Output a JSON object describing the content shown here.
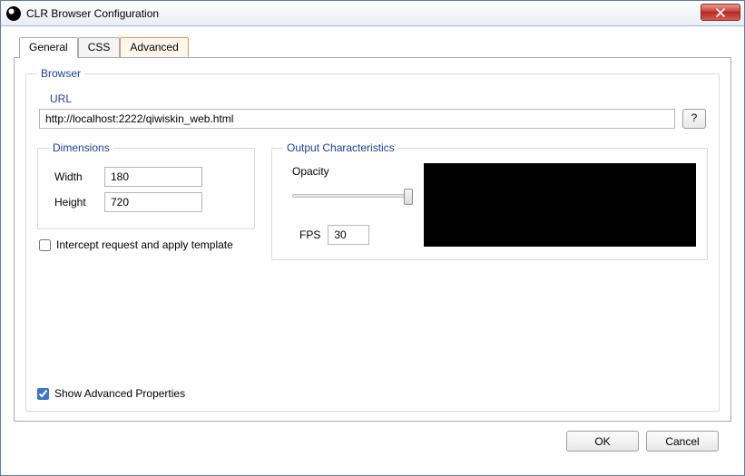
{
  "window": {
    "title": "CLR Browser Configuration"
  },
  "tabs": {
    "general": "General",
    "css": "CSS",
    "advanced": "Advanced"
  },
  "browser": {
    "legend": "Browser",
    "url_label": "URL",
    "url_value": "http://localhost:2222/qiwiskin_web.html",
    "help_label": "?"
  },
  "dimensions": {
    "legend": "Dimensions",
    "width_label": "Width",
    "width_value": "180",
    "height_label": "Height",
    "height_value": "720"
  },
  "intercept": {
    "label": "Intercept request and apply template",
    "checked": false
  },
  "output": {
    "legend": "Output Characteristics",
    "opacity_label": "Opacity",
    "opacity_value": 100,
    "fps_label": "FPS",
    "fps_value": "30"
  },
  "show_advanced": {
    "label": "Show Advanced Properties",
    "checked": true
  },
  "buttons": {
    "ok": "OK",
    "cancel": "Cancel"
  }
}
